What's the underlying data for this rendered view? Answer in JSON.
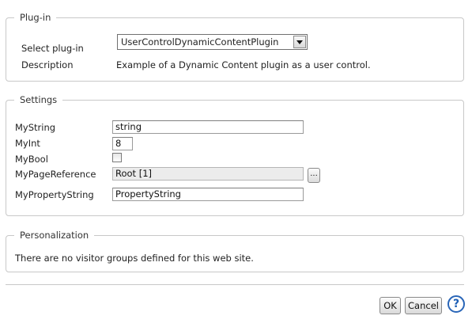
{
  "plugin_section": {
    "legend": "Plug-in",
    "select_label": "Select plug-in",
    "selected_plugin": "UserControlDynamicContentPlugin",
    "description_label": "Description",
    "description_text": "Example of a Dynamic Content plugin as a user control."
  },
  "settings_section": {
    "legend": "Settings",
    "mystring_label": "MyString",
    "mystring_value": "string",
    "myint_label": "MyInt",
    "myint_value": "8",
    "mybool_label": "MyBool",
    "mybool_checked": false,
    "mypagereference_label": "MyPageReference",
    "mypagereference_value": "Root [1]",
    "browse_label": "...",
    "mypropertystring_label": "MyPropertyString",
    "mypropertystring_value": "PropertyString"
  },
  "personalization_section": {
    "legend": "Personalization",
    "message": "There are no visitor groups defined for this web site."
  },
  "buttons": {
    "ok_label": "OK",
    "cancel_label": "Cancel",
    "help_label": "?"
  }
}
